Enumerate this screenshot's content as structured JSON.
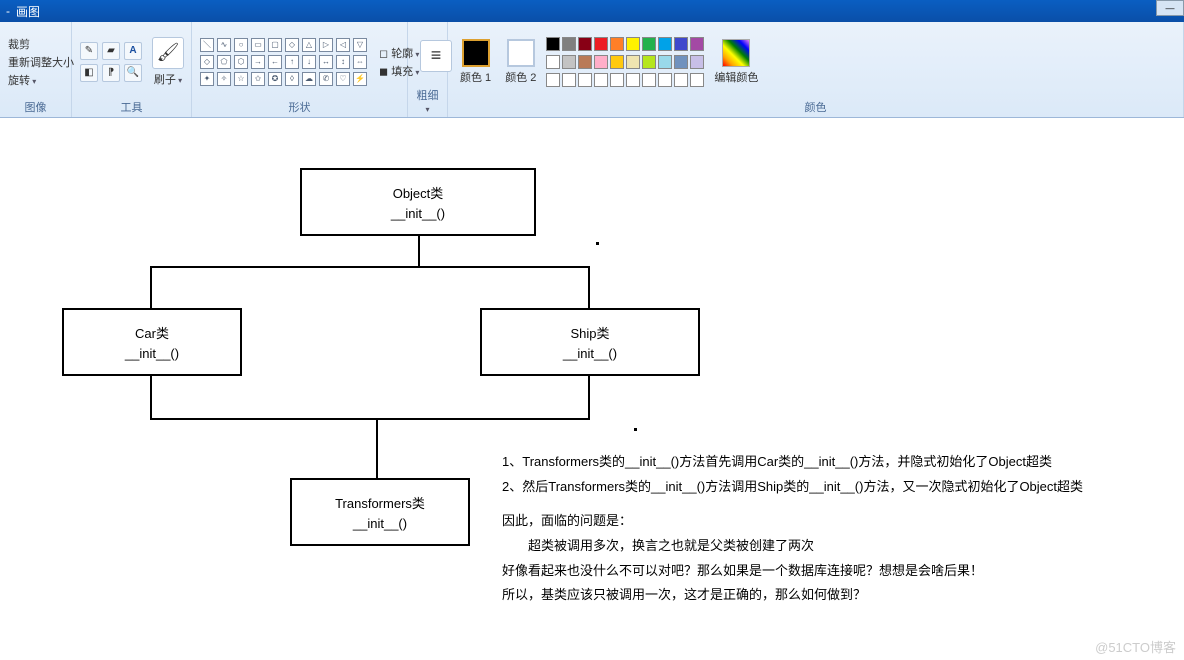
{
  "window": {
    "title_prefix": "-",
    "title": "画图",
    "min_icon": "—"
  },
  "ribbon": {
    "group_image": {
      "label": "图像",
      "crop": "裁剪",
      "resize": "重新调整大小",
      "rotate": "旋转"
    },
    "group_tools": {
      "label": "工具",
      "brush": "刷子"
    },
    "group_shapes": {
      "label": "形状",
      "outline": "轮廓",
      "fill": "填充"
    },
    "group_thickness": {
      "label": "粗细"
    },
    "group_colors": {
      "label": "颜色",
      "color1": "颜色 1",
      "color2": "颜色 2",
      "edit": "编辑颜色",
      "row1": [
        "#000000",
        "#7f7f7f",
        "#880015",
        "#ed1c24",
        "#ff7f27",
        "#fff200",
        "#22b14c",
        "#00a2e8",
        "#3f48cc",
        "#a349a4"
      ],
      "row2": [
        "#ffffff",
        "#c3c3c3",
        "#b97a57",
        "#ffaec9",
        "#ffc90e",
        "#efe4b0",
        "#b5e61d",
        "#99d9ea",
        "#7092be",
        "#c8bfe7"
      ]
    }
  },
  "diagram": {
    "obj": {
      "l1": "Object类",
      "l2": "__init__()"
    },
    "car": {
      "l1": "Car类",
      "l2": "__init__()"
    },
    "ship": {
      "l1": "Ship类",
      "l2": "__init__()"
    },
    "trans": {
      "l1": "Transformers类",
      "l2": "__init__()"
    }
  },
  "notes": {
    "p1": "1、Transformers类的__init__()方法首先调用Car类的__init__()方法，并隐式初始化了Object超类",
    "p2": "2、然后Transformers类的__init__()方法调用Ship类的__init__()方法，又一次隐式初始化了Object超类",
    "p3": "因此，面临的问题是：",
    "p4": "超类被调用多次，换言之也就是父类被创建了两次",
    "p5": "好像看起来也没什么不可以对吧？那么如果是一个数据库连接呢？想想是会啥后果！",
    "p6": "所以，基类应该只被调用一次，这才是正确的，那么如何做到？"
  },
  "watermark": "@51CTO博客"
}
